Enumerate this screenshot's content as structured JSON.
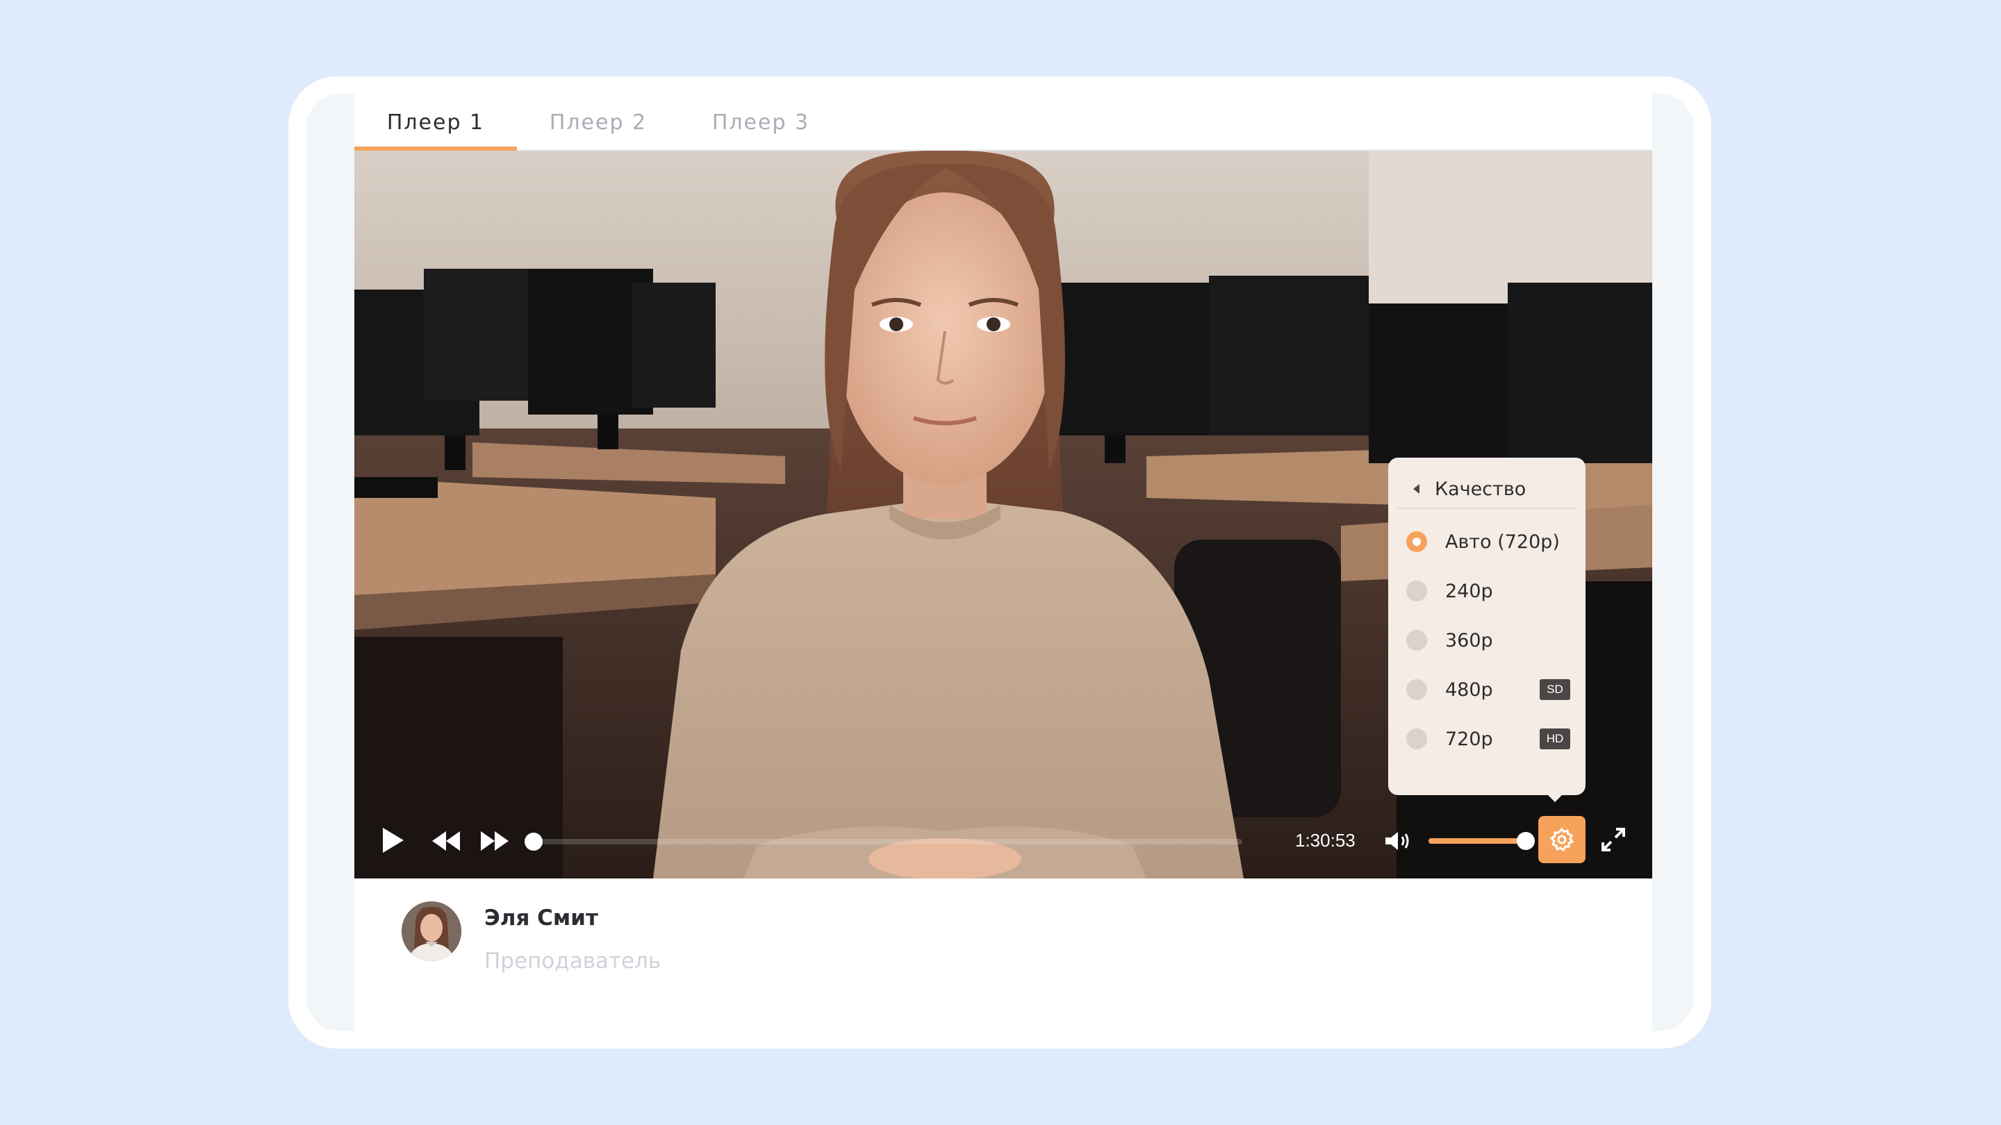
{
  "tabs": [
    {
      "label": "Плеер 1",
      "active": true
    },
    {
      "label": "Плеер 2",
      "active": false
    },
    {
      "label": "Плеер 3",
      "active": false
    }
  ],
  "player": {
    "time_display": "1:30:53",
    "progress_fraction": 0.0,
    "volume_fraction": 1.0,
    "icons": {
      "play": "play-icon",
      "rewind": "rewind-icon",
      "forward": "fast-forward-icon",
      "volume": "volume-icon",
      "settings": "gear-icon",
      "fullscreen": "fullscreen-icon"
    }
  },
  "quality_menu": {
    "title": "Качество",
    "options": [
      {
        "label": "Авто (720p)",
        "selected": true,
        "badge": ""
      },
      {
        "label": "240p",
        "selected": false,
        "badge": ""
      },
      {
        "label": "360p",
        "selected": false,
        "badge": ""
      },
      {
        "label": "480p",
        "selected": false,
        "badge": "SD"
      },
      {
        "label": "720p",
        "selected": false,
        "badge": "HD"
      }
    ]
  },
  "presenter": {
    "name": "Эля Смит",
    "role": "Преподаватель"
  },
  "colors": {
    "accent": "#f7a25a",
    "background": "#dfeafc",
    "menu_bg": "#f6ece6"
  }
}
